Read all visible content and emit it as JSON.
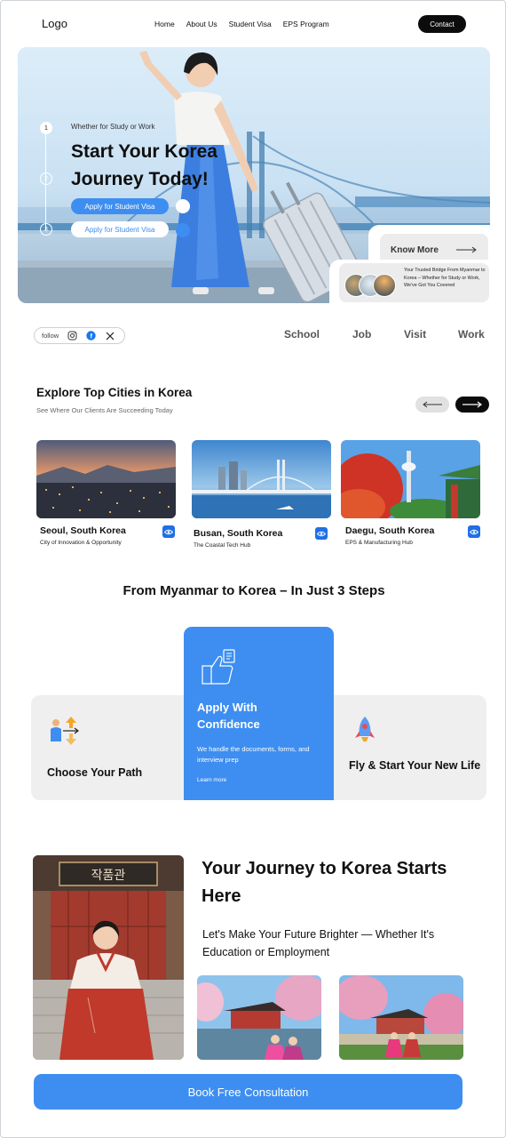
{
  "header": {
    "logo": "Logo",
    "nav": [
      "Home",
      "About Us",
      "Student Visa",
      "EPS Program"
    ],
    "contact": "Contact"
  },
  "hero": {
    "steps": [
      "1",
      "2",
      "3"
    ],
    "kicker": "Whether for Study or Work",
    "title": "Start Your Korea Journey Today!",
    "btn_primary": "Apply for Student Visa",
    "btn_secondary": "Apply for Student Visa",
    "know_more": "Know More",
    "bridge_text": "Your Trusted Bridge From Myanmar to Korea – Whether for Study or Work, We've Got You Covered"
  },
  "social": {
    "follow": "follow",
    "icons": [
      "instagram-icon",
      "facebook-icon",
      "x-icon"
    ]
  },
  "categories": [
    "School",
    "Job",
    "Visit",
    "Work"
  ],
  "cities": {
    "title": "Explore Top Cities in Korea",
    "subtitle": "See Where Our Clients Are Succeeding Today",
    "items": [
      {
        "name": "Seoul, South Korea",
        "desc": "City of Innovation & Opportunity"
      },
      {
        "name": "Busan, South Korea",
        "desc": "The Coastal Tech Hub"
      },
      {
        "name": "Daegu, South Korea",
        "desc": "EPS & Manufacturing Hub"
      }
    ]
  },
  "steps": {
    "title": "From Myanmar to Korea – In Just 3 Steps",
    "step1": "Choose Your Path",
    "step2_title": "Apply With Confidence",
    "step2_desc": "We handle the documents, forms, and interview prep",
    "step2_link": "Learn more",
    "step3": "Fly & Start Your New Life"
  },
  "journey": {
    "title": "Your Journey to Korea Starts Here",
    "subtitle": "Let's Make Your Future Brighter — Whether It's Education or Employment",
    "cta": "Book Free Consultation"
  },
  "colors": {
    "accent": "#3d8ef0",
    "dark": "#0c0c0c",
    "band": "#efefef"
  }
}
